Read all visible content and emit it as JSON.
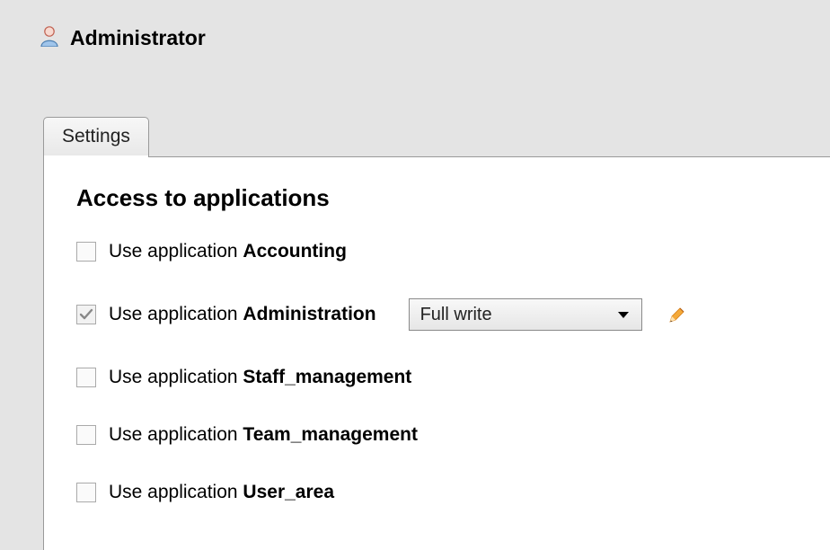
{
  "header": {
    "title": "Administrator"
  },
  "tabs": [
    {
      "label": "Settings"
    }
  ],
  "section": {
    "title": "Access to applications",
    "row_prefix": "Use application "
  },
  "applications": [
    {
      "name": "Accounting",
      "checked": false
    },
    {
      "name": "Administration",
      "checked": true,
      "permission": "Full write",
      "editable": true
    },
    {
      "name": "Staff_management",
      "checked": false
    },
    {
      "name": "Team_management",
      "checked": false
    },
    {
      "name": "User_area",
      "checked": false
    }
  ]
}
